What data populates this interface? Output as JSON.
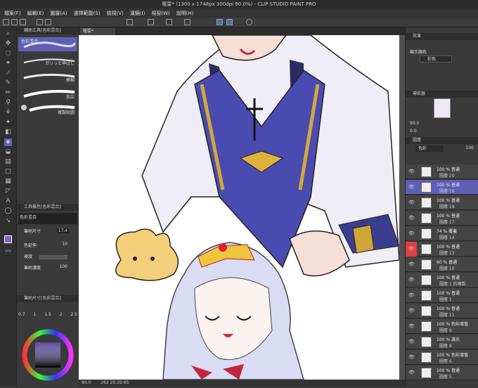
{
  "app": {
    "title": "喔耍* (1300 x 1748px 300dpi 90.0%) - CLIP STUDIO PAINT PRO"
  },
  "menu": [
    "檔案(F)",
    "編輯(E)",
    "圖層(A)",
    "選擇範圍(S)",
    "檢視(V)",
    "濾鏡(I)",
    "視窗(W)",
    "說明(H)"
  ],
  "tab": {
    "label": "喔耍*"
  },
  "subtool": {
    "header": "輔助工具[色彩混合]",
    "items": [
      "色彩混合",
      "模糊",
      "指尖",
      "複製貼圖"
    ],
    "selected": "色彩混合",
    "extra": "ガリっと伸ばし"
  },
  "toolprop": {
    "header": "工具屬性[色彩混合]",
    "name": "色彩混合",
    "rows": [
      {
        "label": "筆刷尺寸",
        "value": "17.4"
      },
      {
        "label": "色延伸",
        "value": "10"
      },
      {
        "label": "硬度",
        "value": ""
      },
      {
        "label": "筆刷濃度",
        "value": "100"
      }
    ]
  },
  "brushsize": {
    "header": "筆刷尺寸[色彩混合]",
    "values": [
      "0.7",
      "1",
      "1.5",
      "2",
      "2.5"
    ]
  },
  "right": {
    "effect_header": "效果",
    "display_color_label": "顯示顏色",
    "display_color_value": "彩色",
    "navigator_header": "導航器",
    "zoom": "90.0",
    "rotation": "0.0",
    "layer_header": "圖層",
    "blend": "色彩",
    "opacity": "100"
  },
  "layers": [
    {
      "mode": "100 % 普通",
      "name": "圖層 20",
      "red": false,
      "sel": false
    },
    {
      "mode": "100 % 普通",
      "name": "圖層 18",
      "red": false,
      "sel": true
    },
    {
      "mode": "100 % 普通",
      "name": "圖層 19",
      "red": false,
      "sel": false
    },
    {
      "mode": "100 % 普通",
      "name": "圖層 17",
      "red": false,
      "sel": false
    },
    {
      "mode": "74 % 覆蓋",
      "name": "圖層 14",
      "red": false,
      "sel": false
    },
    {
      "mode": "100 % 普通",
      "name": "圖層 13",
      "red": true,
      "sel": false
    },
    {
      "mode": "60 % 普通",
      "name": "圖層 10",
      "red": false,
      "sel": false
    },
    {
      "mode": "100 % 普通",
      "name": "圖層 1 的複製",
      "red": false,
      "sel": false
    },
    {
      "mode": "100 % 普通",
      "name": "圖層 1",
      "red": false,
      "sel": false
    },
    {
      "mode": "100 % 普通",
      "name": "圖層 11",
      "red": false,
      "sel": false
    },
    {
      "mode": "100 % 色彩增值",
      "name": "圖層 9",
      "red": false,
      "sel": false
    },
    {
      "mode": "100 % 濾光",
      "name": "圖層 8",
      "red": false,
      "sel": false
    },
    {
      "mode": "100 % 色彩增值",
      "name": "圖層 6",
      "red": false,
      "sel": false
    },
    {
      "mode": "100 % 普通",
      "name": "圖層 5",
      "red": false,
      "sel": false
    }
  ],
  "status": {
    "zoom": "90.0",
    "coords": "262 20 29 85"
  }
}
